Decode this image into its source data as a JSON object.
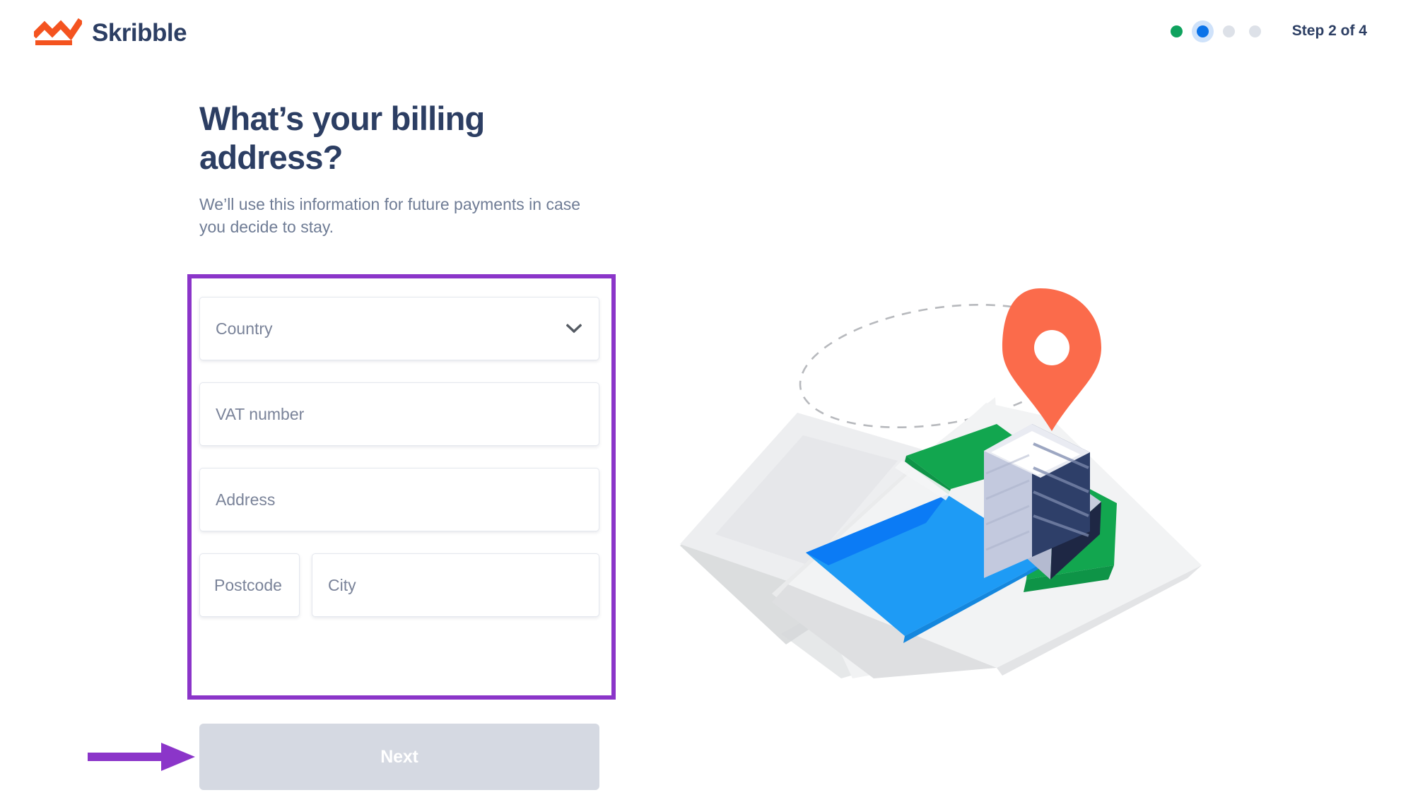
{
  "brand": {
    "name": "Skribble",
    "logo_icon": "skribble-chart-logo",
    "logo_color": "#F4531F",
    "name_color": "#2C3E63"
  },
  "progress": {
    "label": "Step 2 of 4",
    "current_index": 2,
    "total": 4,
    "dots": [
      {
        "state": "done",
        "color": "#0FA25E"
      },
      {
        "state": "current",
        "color": "#0A72E8"
      },
      {
        "state": "todo",
        "color": "#DDE1E8"
      },
      {
        "state": "todo",
        "color": "#DDE1E8"
      }
    ]
  },
  "main": {
    "title": "What’s your billing address?",
    "subtitle": "We’ll use this information for future payments in case you decide to stay."
  },
  "form": {
    "fields": [
      {
        "name": "country",
        "placeholder": "Country",
        "value": "",
        "type": "select",
        "icon": "chevron-down-icon"
      },
      {
        "name": "vat",
        "placeholder": "VAT number",
        "value": "",
        "type": "text"
      },
      {
        "name": "address",
        "placeholder": "Address",
        "value": "",
        "type": "text"
      },
      {
        "name": "postcode",
        "placeholder": "Postcode",
        "value": "",
        "type": "text"
      },
      {
        "name": "city",
        "placeholder": "City",
        "value": "",
        "type": "text"
      }
    ],
    "submit_label": "Next",
    "submit_state": "disabled",
    "submit_bg": "#D5D9E2"
  },
  "annotations": {
    "color": "#8B35C9",
    "box_target": "billing-address-form",
    "arrow_target": "next-button"
  },
  "illustration": {
    "name": "isometric-map-with-location-pin",
    "pin_color": "#FB6B4B",
    "water_color": "#1E9BF5",
    "park_color": "#12A64F",
    "building_dark": "#2E3F69",
    "building_light": "#C3C9DE",
    "map_gray": "#EDEEF0"
  }
}
